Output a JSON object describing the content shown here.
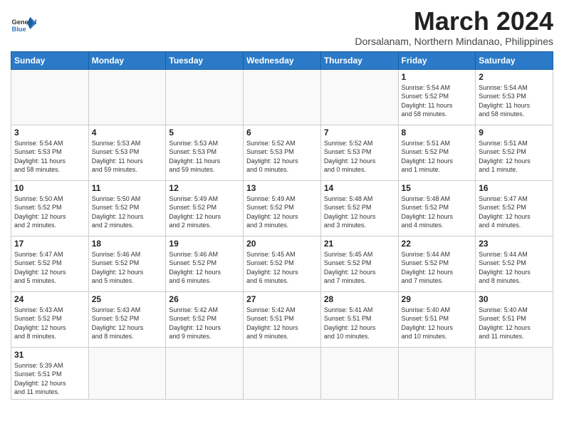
{
  "logo": {
    "text_general": "General",
    "text_blue": "Blue"
  },
  "title": "March 2024",
  "subtitle": "Dorsalanam, Northern Mindanao, Philippines",
  "headers": [
    "Sunday",
    "Monday",
    "Tuesday",
    "Wednesday",
    "Thursday",
    "Friday",
    "Saturday"
  ],
  "weeks": [
    [
      {
        "day": "",
        "info": ""
      },
      {
        "day": "",
        "info": ""
      },
      {
        "day": "",
        "info": ""
      },
      {
        "day": "",
        "info": ""
      },
      {
        "day": "",
        "info": ""
      },
      {
        "day": "1",
        "info": "Sunrise: 5:54 AM\nSunset: 5:52 PM\nDaylight: 11 hours\nand 58 minutes."
      },
      {
        "day": "2",
        "info": "Sunrise: 5:54 AM\nSunset: 5:53 PM\nDaylight: 11 hours\nand 58 minutes."
      }
    ],
    [
      {
        "day": "3",
        "info": "Sunrise: 5:54 AM\nSunset: 5:53 PM\nDaylight: 11 hours\nand 58 minutes."
      },
      {
        "day": "4",
        "info": "Sunrise: 5:53 AM\nSunset: 5:53 PM\nDaylight: 11 hours\nand 59 minutes."
      },
      {
        "day": "5",
        "info": "Sunrise: 5:53 AM\nSunset: 5:53 PM\nDaylight: 11 hours\nand 59 minutes."
      },
      {
        "day": "6",
        "info": "Sunrise: 5:52 AM\nSunset: 5:53 PM\nDaylight: 12 hours\nand 0 minutes."
      },
      {
        "day": "7",
        "info": "Sunrise: 5:52 AM\nSunset: 5:53 PM\nDaylight: 12 hours\nand 0 minutes."
      },
      {
        "day": "8",
        "info": "Sunrise: 5:51 AM\nSunset: 5:52 PM\nDaylight: 12 hours\nand 1 minute."
      },
      {
        "day": "9",
        "info": "Sunrise: 5:51 AM\nSunset: 5:52 PM\nDaylight: 12 hours\nand 1 minute."
      }
    ],
    [
      {
        "day": "10",
        "info": "Sunrise: 5:50 AM\nSunset: 5:52 PM\nDaylight: 12 hours\nand 2 minutes."
      },
      {
        "day": "11",
        "info": "Sunrise: 5:50 AM\nSunset: 5:52 PM\nDaylight: 12 hours\nand 2 minutes."
      },
      {
        "day": "12",
        "info": "Sunrise: 5:49 AM\nSunset: 5:52 PM\nDaylight: 12 hours\nand 2 minutes."
      },
      {
        "day": "13",
        "info": "Sunrise: 5:49 AM\nSunset: 5:52 PM\nDaylight: 12 hours\nand 3 minutes."
      },
      {
        "day": "14",
        "info": "Sunrise: 5:48 AM\nSunset: 5:52 PM\nDaylight: 12 hours\nand 3 minutes."
      },
      {
        "day": "15",
        "info": "Sunrise: 5:48 AM\nSunset: 5:52 PM\nDaylight: 12 hours\nand 4 minutes."
      },
      {
        "day": "16",
        "info": "Sunrise: 5:47 AM\nSunset: 5:52 PM\nDaylight: 12 hours\nand 4 minutes."
      }
    ],
    [
      {
        "day": "17",
        "info": "Sunrise: 5:47 AM\nSunset: 5:52 PM\nDaylight: 12 hours\nand 5 minutes."
      },
      {
        "day": "18",
        "info": "Sunrise: 5:46 AM\nSunset: 5:52 PM\nDaylight: 12 hours\nand 5 minutes."
      },
      {
        "day": "19",
        "info": "Sunrise: 5:46 AM\nSunset: 5:52 PM\nDaylight: 12 hours\nand 6 minutes."
      },
      {
        "day": "20",
        "info": "Sunrise: 5:45 AM\nSunset: 5:52 PM\nDaylight: 12 hours\nand 6 minutes."
      },
      {
        "day": "21",
        "info": "Sunrise: 5:45 AM\nSunset: 5:52 PM\nDaylight: 12 hours\nand 7 minutes."
      },
      {
        "day": "22",
        "info": "Sunrise: 5:44 AM\nSunset: 5:52 PM\nDaylight: 12 hours\nand 7 minutes."
      },
      {
        "day": "23",
        "info": "Sunrise: 5:44 AM\nSunset: 5:52 PM\nDaylight: 12 hours\nand 8 minutes."
      }
    ],
    [
      {
        "day": "24",
        "info": "Sunrise: 5:43 AM\nSunset: 5:52 PM\nDaylight: 12 hours\nand 8 minutes."
      },
      {
        "day": "25",
        "info": "Sunrise: 5:43 AM\nSunset: 5:52 PM\nDaylight: 12 hours\nand 8 minutes."
      },
      {
        "day": "26",
        "info": "Sunrise: 5:42 AM\nSunset: 5:52 PM\nDaylight: 12 hours\nand 9 minutes."
      },
      {
        "day": "27",
        "info": "Sunrise: 5:42 AM\nSunset: 5:51 PM\nDaylight: 12 hours\nand 9 minutes."
      },
      {
        "day": "28",
        "info": "Sunrise: 5:41 AM\nSunset: 5:51 PM\nDaylight: 12 hours\nand 10 minutes."
      },
      {
        "day": "29",
        "info": "Sunrise: 5:40 AM\nSunset: 5:51 PM\nDaylight: 12 hours\nand 10 minutes."
      },
      {
        "day": "30",
        "info": "Sunrise: 5:40 AM\nSunset: 5:51 PM\nDaylight: 12 hours\nand 11 minutes."
      }
    ],
    [
      {
        "day": "31",
        "info": "Sunrise: 5:39 AM\nSunset: 5:51 PM\nDaylight: 12 hours\nand 11 minutes."
      },
      {
        "day": "",
        "info": ""
      },
      {
        "day": "",
        "info": ""
      },
      {
        "day": "",
        "info": ""
      },
      {
        "day": "",
        "info": ""
      },
      {
        "day": "",
        "info": ""
      },
      {
        "day": "",
        "info": ""
      }
    ]
  ]
}
